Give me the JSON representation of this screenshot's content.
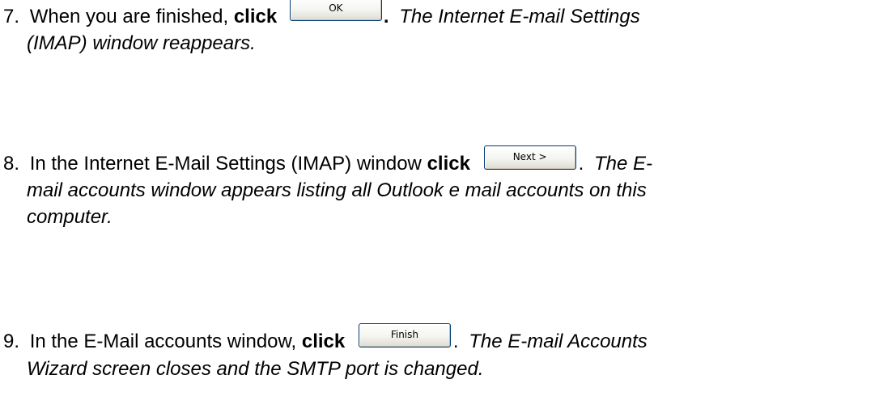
{
  "steps": [
    {
      "number": "7.",
      "intro": "When you are finished, ",
      "action_word": "click",
      "button_label": "OK",
      "after_button": ".",
      "note_line1": "The Internet E-mail Settings",
      "note_line2": "(IMAP) window reappears."
    },
    {
      "number": "8.",
      "intro": "In the Internet E-Mail Settings (IMAP) window ",
      "action_word": "click",
      "button_label": "Next >",
      "after_button": ".",
      "note_line1": "The E-",
      "note_line2": "mail accounts window appears listing all Outlook e mail accounts on this",
      "note_line3": "computer."
    },
    {
      "number": "9.",
      "intro": "In the E-Mail accounts window, ",
      "action_word": "click",
      "button_label": "Finish",
      "after_button": ".",
      "note_line1": "The E-mail Accounts",
      "note_line2": "Wizard screen closes and the SMTP port is changed."
    }
  ]
}
